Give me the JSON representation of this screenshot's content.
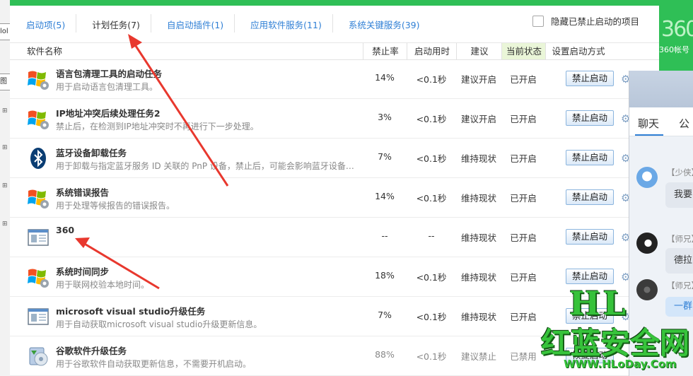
{
  "tabs": [
    {
      "label": "启动项(5)"
    },
    {
      "label": "计划任务(7)"
    },
    {
      "label": "自启动插件(1)"
    },
    {
      "label": "应用软件服务(11)"
    },
    {
      "label": "系统关键服务(39)"
    }
  ],
  "hide_disabled_label": "隐藏已禁止启动的项目",
  "columns": {
    "name": "软件名称",
    "disable_rate": "禁止率",
    "boot_time": "启动用时",
    "advice": "建议",
    "status": "当前状态",
    "setting": "设置启动方式"
  },
  "rows": [
    {
      "name": "语言包清理工具的启动任务",
      "desc": "用于启动语言包清理工具。",
      "rate": "14%",
      "time": "<0.1秒",
      "advice": "建议开启",
      "status": "已开启",
      "action": "禁止启动",
      "icon": "windows-flag-icon"
    },
    {
      "name": "IP地址冲突后续处理任务2",
      "desc": "禁止后，在检测到IP地址冲突时不再进行下一步处理。",
      "rate": "3%",
      "time": "<0.1秒",
      "advice": "建议开启",
      "status": "已开启",
      "action": "禁止启动",
      "icon": "windows-flag-icon"
    },
    {
      "name": "蓝牙设备卸载任务",
      "desc": "用于卸载与指定蓝牙服务 ID 关联的 PnP 设备，禁止后，可能会影响蓝牙设备的...",
      "rate": "7%",
      "time": "<0.1秒",
      "advice": "维持现状",
      "status": "已开启",
      "action": "禁止启动",
      "icon": "bluetooth-icon"
    },
    {
      "name": "系统错误报告",
      "desc": "用于处理等候报告的错误报告。",
      "rate": "14%",
      "time": "<0.1秒",
      "advice": "维持现状",
      "status": "已开启",
      "action": "禁止启动",
      "icon": "windows-flag-icon"
    },
    {
      "name": "360",
      "desc": "",
      "rate": "--",
      "time": "--",
      "advice": "维持现状",
      "status": "已开启",
      "action": "禁止启动",
      "icon": "app-window-icon"
    },
    {
      "name": "系统时间同步",
      "desc": "用于联网校验本地时间。",
      "rate": "18%",
      "time": "<0.1秒",
      "advice": "维持现状",
      "status": "已开启",
      "action": "禁止启动",
      "icon": "windows-flag-icon"
    },
    {
      "name": "microsoft visual studio升级任务",
      "desc": "用于自动获取microsoft visual studio升级更新信息。",
      "rate": "7%",
      "time": "<0.1秒",
      "advice": "维持现状",
      "status": "已开启",
      "action": "禁止启动",
      "icon": "app-window-icon"
    },
    {
      "name": "谷歌软件升级任务",
      "desc": "用于谷歌软件自动获取更新信息，不需要开机启动。",
      "rate": "88%",
      "time": "<0.1秒",
      "advice": "建议禁止",
      "status": "已禁用",
      "action": "恢复启动",
      "icon": "installer-icon"
    }
  ],
  "side_panel": {
    "logo_text": "360",
    "account_label": "360帐号"
  },
  "chat": {
    "tab_active": "聊天",
    "tab_other": "公",
    "messages": [
      {
        "name": "【少侠】",
        "text": "我要"
      },
      {
        "name": "【师兄】",
        "text": "德拉"
      },
      {
        "name": "【师兄】",
        "text": "一群"
      }
    ]
  },
  "watermark": {
    "line1": "HL",
    "line2": "红蓝安全网",
    "line3": "WWW.HLoDay.Com"
  },
  "left_frame": {
    "tab1": "lol",
    "tab2": "图"
  }
}
